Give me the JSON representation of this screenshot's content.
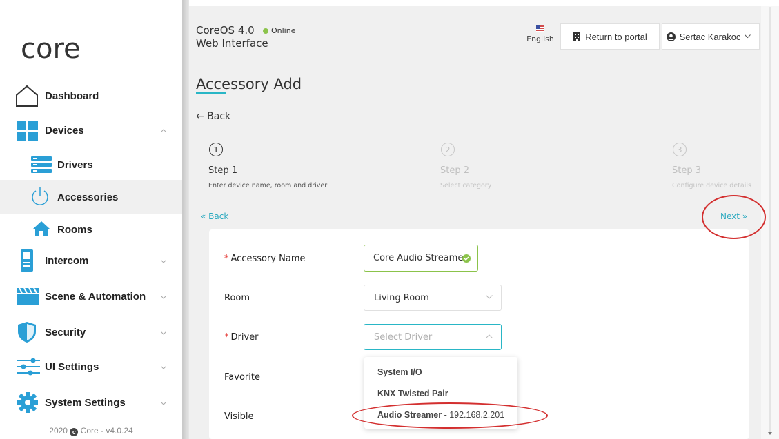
{
  "header": {
    "app_title_line1": "CoreOS 4.0",
    "app_title_line2": "Web Interface",
    "status": "Online",
    "status_color": "#8bc34a",
    "language": "English",
    "return_portal_label": "Return to portal",
    "user_name": "Sertac Karakoc"
  },
  "sidebar": {
    "logo_text": "core",
    "items": [
      {
        "label": "Dashboard",
        "icon": "home-icon"
      },
      {
        "label": "Devices",
        "icon": "grid-icon",
        "expanded": true
      },
      {
        "label": "Drivers",
        "icon": "server-icon"
      },
      {
        "label": "Accessories",
        "icon": "power-icon",
        "active": true
      },
      {
        "label": "Rooms",
        "icon": "house-icon"
      },
      {
        "label": "Intercom",
        "icon": "intercom-icon"
      },
      {
        "label": "Scene & Automation",
        "icon": "clapper-icon"
      },
      {
        "label": "Security",
        "icon": "shield-icon"
      },
      {
        "label": "UI Settings",
        "icon": "sliders-icon"
      },
      {
        "label": "System Settings",
        "icon": "gear-icon"
      }
    ],
    "copyright_year": "2020",
    "copyright_text": "Core - v4.0.24"
  },
  "page": {
    "title": "Accessory Add",
    "back_label": "← Back",
    "accent_color": "#29b6c6"
  },
  "steps": [
    {
      "number": "1",
      "title": "Step 1",
      "desc": "Enter device name, room and driver",
      "active": true
    },
    {
      "number": "2",
      "title": "Step 2",
      "desc": "Select category",
      "active": false
    },
    {
      "number": "3",
      "title": "Step 3",
      "desc": "Configure device details",
      "active": false
    }
  ],
  "wizard_nav": {
    "back_label": "« Back",
    "next_label": "Next »"
  },
  "form": {
    "accessory_name_label": "Accessory Name",
    "accessory_name_value": "Core Audio Streamer",
    "room_label": "Room",
    "room_value": "Living Room",
    "driver_label": "Driver",
    "driver_placeholder": "Select Driver",
    "favorite_label": "Favorite",
    "visible_label": "Visible",
    "required_marker": "*"
  },
  "driver_dropdown": {
    "options": [
      {
        "name": "System I/O",
        "detail": ""
      },
      {
        "name": "KNX Twisted Pair",
        "detail": ""
      },
      {
        "name": "Audio Streamer",
        "detail": " - 192.168.2.201"
      }
    ]
  },
  "colors": {
    "annotation_red": "#d32f2f",
    "link": "#29a9bf",
    "success_green": "#8bc34a"
  }
}
